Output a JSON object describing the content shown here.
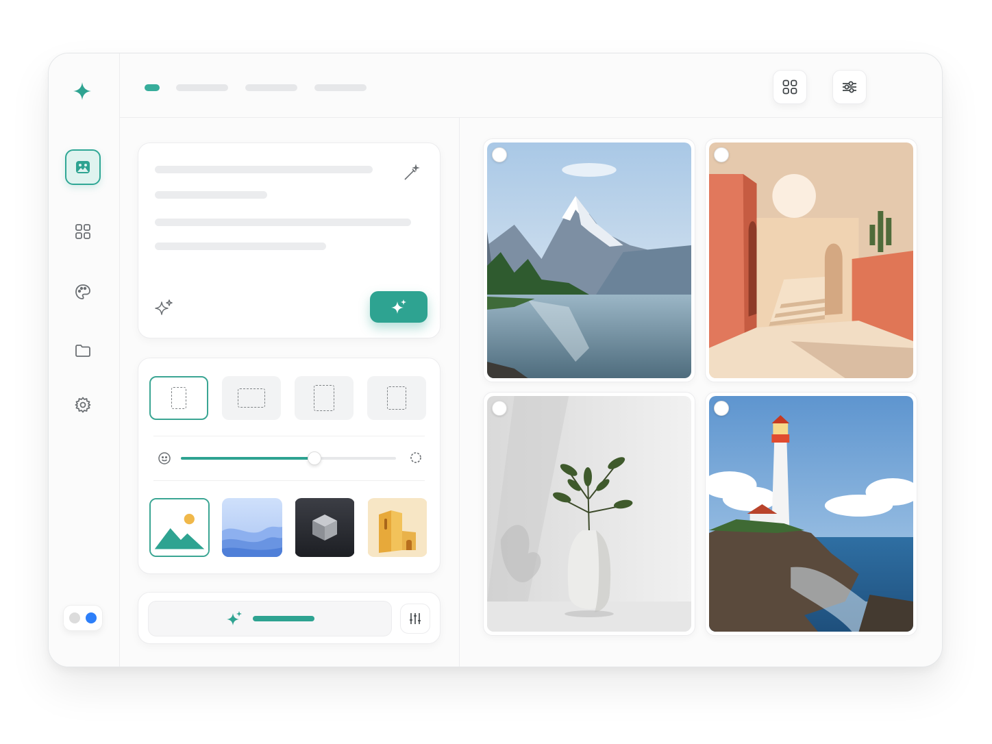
{
  "app": {
    "logo_icon": "sparkle-logo-icon",
    "accent_color": "#2ea391",
    "avatar_color": "#2d7ff9"
  },
  "sidebar": {
    "items": [
      {
        "icon": "image-gallery-icon",
        "active": true
      },
      {
        "icon": "grid-icon",
        "active": false
      },
      {
        "icon": "palette-icon",
        "active": false
      },
      {
        "icon": "folder-icon",
        "active": false
      },
      {
        "icon": "gear-icon",
        "active": false
      }
    ],
    "theme_toggle": {
      "state": "on"
    }
  },
  "topbar": {
    "breadcrumbs_count": 4,
    "buttons": [
      "grid-view-icon",
      "sliders-icon"
    ]
  },
  "prompt_panel": {
    "tools": [
      "magic-wand-icon",
      "sparkles-outline-icon"
    ],
    "generate_icon": "sparkles-icon"
  },
  "settings": {
    "aspect_ratios": [
      "portrait",
      "landscape",
      "portrait",
      "portrait"
    ],
    "selected_ratio": 0,
    "slider_value": 0.62,
    "styles": [
      "landscape-illustration",
      "soft-gradient",
      "3d-render",
      "architecture"
    ],
    "selected_style": 0
  },
  "action": {
    "icon": "sparkles-icon",
    "adjust_icon": "sliders-vertical-icon"
  },
  "gallery": {
    "images": [
      "mountain-lake",
      "terracotta-courtyard",
      "vase-plant",
      "lighthouse-coast"
    ]
  }
}
